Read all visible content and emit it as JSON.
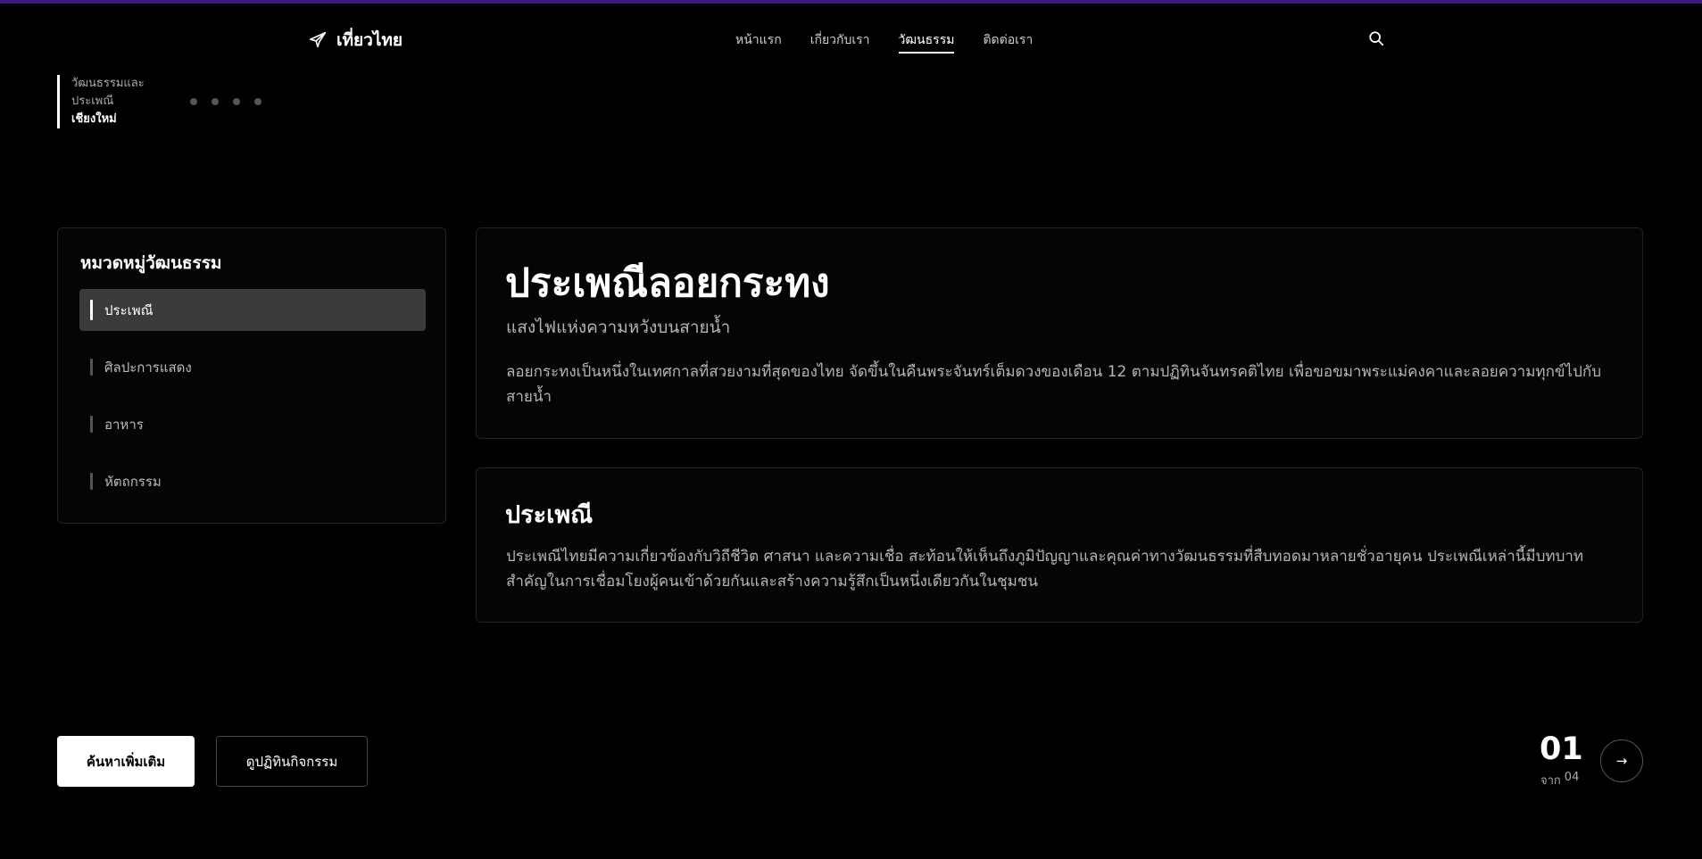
{
  "header": {
    "brand": "เที่ยวไทย",
    "nav": [
      {
        "label": "หน้าแรก",
        "active": false
      },
      {
        "label": "เกี่ยวกับเรา",
        "active": false
      },
      {
        "label": "วัฒนธรรม",
        "active": true
      },
      {
        "label": "ติดต่อเรา",
        "active": false
      }
    ]
  },
  "slide_indicator": {
    "line1": "วัฒนธรรมและ",
    "line2": "ประเพณี",
    "line3": "เชียงใหม่"
  },
  "sidebar": {
    "title": "หมวดหมู่วัฒนธรรม",
    "items": [
      {
        "label": "ประเพณี",
        "active": true
      },
      {
        "label": "ศิลปะการแสดง",
        "active": false
      },
      {
        "label": "อาหาร",
        "active": false
      },
      {
        "label": "หัตถกรรม",
        "active": false
      }
    ]
  },
  "feature": {
    "title": "ประเพณีลอยกระทง",
    "subtitle": "แสงไฟแห่งความหวังบนสายน้ำ",
    "description": "ลอยกระทงเป็นหนึ่งในเทศกาลที่สวยงามที่สุดของไทย จัดขึ้นในคืนพระจันทร์เต็มดวงของเดือน 12 ตามปฏิทินจันทรคติไทย เพื่อขอขมาพระแม่คงคาและลอยความทุกข์ไปกับสายน้ำ"
  },
  "section": {
    "title": "ประเพณี",
    "description": "ประเพณีไทยมีความเกี่ยวข้องกับวิถีชีวิต ศาสนา และความเชื่อ สะท้อนให้เห็นถึงภูมิปัญญาและคุณค่าทางวัฒนธรรมที่สืบทอดมาหลายชั่วอายุคน ประเพณีเหล่านี้มีบทบาทสำคัญในการเชื่อมโยงผู้คนเข้าด้วยกันและสร้างความรู้สึกเป็นหนึ่งเดียวกันในชุมชน"
  },
  "buttons": {
    "primary": "ค้นหาเพิ่มเติม",
    "secondary": "ดูปฏิทินกิจกรรม"
  },
  "pagination": {
    "current": "01",
    "of_label": "จาก",
    "total": "04",
    "next_symbol": "→"
  },
  "colors": {
    "background": "#000000",
    "accent_line": "#3b1a78",
    "active_item_bg": "#3a3a3a"
  }
}
